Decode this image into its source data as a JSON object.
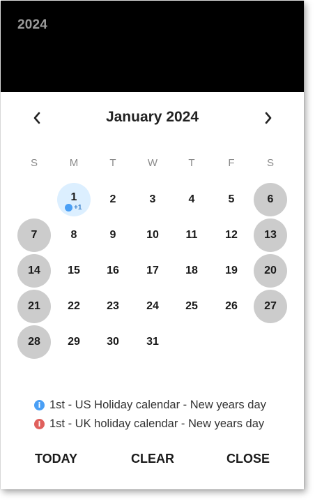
{
  "header": {
    "year": "2024"
  },
  "nav": {
    "month_title": "January 2024",
    "prev_icon": "chevron-left-icon",
    "next_icon": "chevron-right-icon"
  },
  "weekdays": [
    "S",
    "M",
    "T",
    "W",
    "T",
    "F",
    "S"
  ],
  "weeks": [
    [
      "",
      "1",
      "2",
      "3",
      "4",
      "5",
      "6"
    ],
    [
      "7",
      "8",
      "9",
      "10",
      "11",
      "12",
      "13"
    ],
    [
      "14",
      "15",
      "16",
      "17",
      "18",
      "19",
      "20"
    ],
    [
      "21",
      "22",
      "23",
      "24",
      "25",
      "26",
      "27"
    ],
    [
      "28",
      "29",
      "30",
      "31",
      "",
      "",
      ""
    ]
  ],
  "selected_day": "1",
  "day_1_event_more": "+1",
  "events": [
    {
      "label": "1st - US Holiday calendar - New years day",
      "icon": "info-icon",
      "color": "#4a9ff5"
    },
    {
      "label": "1st - UK holiday calendar - New years day",
      "icon": "info-icon",
      "color": "#e0605c"
    }
  ],
  "actions": {
    "today": "TODAY",
    "clear": "CLEAR",
    "close": "CLOSE"
  },
  "colors": {
    "header_bg": "#000000",
    "weekend_bg": "#cccccc",
    "selected_bg": "#dcefff",
    "event_dot": "#4a9ff5"
  }
}
